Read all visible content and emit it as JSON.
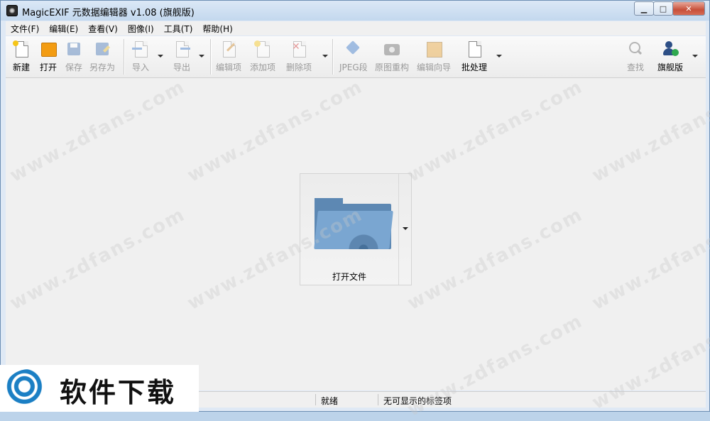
{
  "window": {
    "title": "MagicEXIF 元数据编辑器 v1.08 (旗舰版)"
  },
  "menu": [
    "文件(F)",
    "编辑(E)",
    "查看(V)",
    "图像(I)",
    "工具(T)",
    "帮助(H)"
  ],
  "toolbar": {
    "new": "新建",
    "open": "打开",
    "save": "保存",
    "save_as": "另存为",
    "import": "导入",
    "export": "导出",
    "edit_item": "编辑项",
    "add_item": "添加项",
    "delete_item": "删除项",
    "jpeg_segment": "JPEG段",
    "rebuild": "原图重构",
    "wizard": "编辑向导",
    "batch": "批处理",
    "find": "查找",
    "edition": "旗舰版"
  },
  "main": {
    "open_file_label": "打开文件"
  },
  "status": {
    "ready": "就绪",
    "no_tags": "无可显示的标签项"
  },
  "watermark": "www.zdfans.com",
  "logo": {
    "text": "软件下载"
  },
  "colors": {
    "accent": "#5d88b3",
    "folder": "#7aa6d1",
    "disabled_text": "#9a9a9a"
  }
}
